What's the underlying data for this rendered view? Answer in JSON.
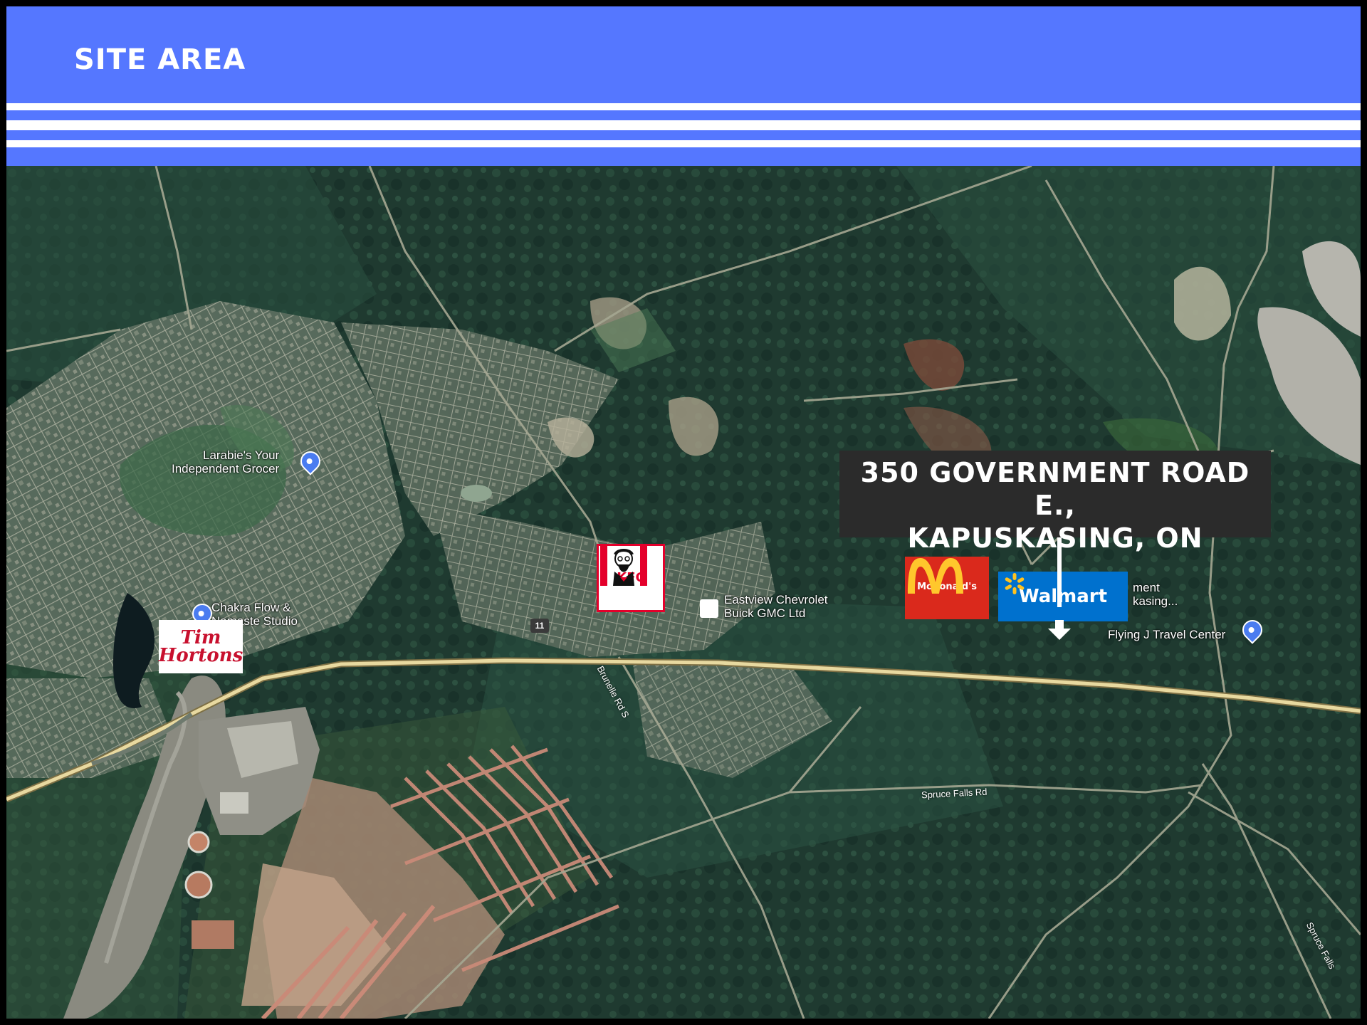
{
  "header": {
    "title": "SITE AREA",
    "background_color": "#5577ff",
    "stripe_color": "#ffffff"
  },
  "address": {
    "line1": "350 GOVERNMENT ROAD E.,",
    "line2": "KAPUSKASING, ON"
  },
  "places": {
    "larabies": "Larabie's Your\nIndependent Grocer",
    "chakra": "Chakra Flow &\nNamaste Studio",
    "eastview": "Eastview Chevrolet\nBuick GMC Ltd",
    "flying_j": "Flying J Travel Center",
    "walmart_partial": "ment\nkasing..."
  },
  "roads": {
    "highway": "11",
    "brunelle": "Brunelle Rd S",
    "spruce_falls": "Spruce Falls Rd",
    "spruce_falls_east": "Spruce Falls"
  },
  "logos": {
    "tim_hortons": "Tim\nHortons",
    "kfc": "KFC",
    "mcdonalds": "McDonald's",
    "walmart": "Walmart"
  },
  "icons": {
    "place_pin": "map-pin-icon",
    "shopping_pin": "shopping-bag-icon"
  },
  "colors": {
    "address_box": "#2b2b2b",
    "highway": "#e8d9a0",
    "roads": "#b9b9a4",
    "forest": "#1f3a30",
    "tim_red": "#c8102e",
    "kfc_red": "#e4002b",
    "mcd_red": "#da291c",
    "mcd_gold": "#ffc72c",
    "walmart_blue": "#0071ce",
    "walmart_spark": "#ffc220"
  }
}
